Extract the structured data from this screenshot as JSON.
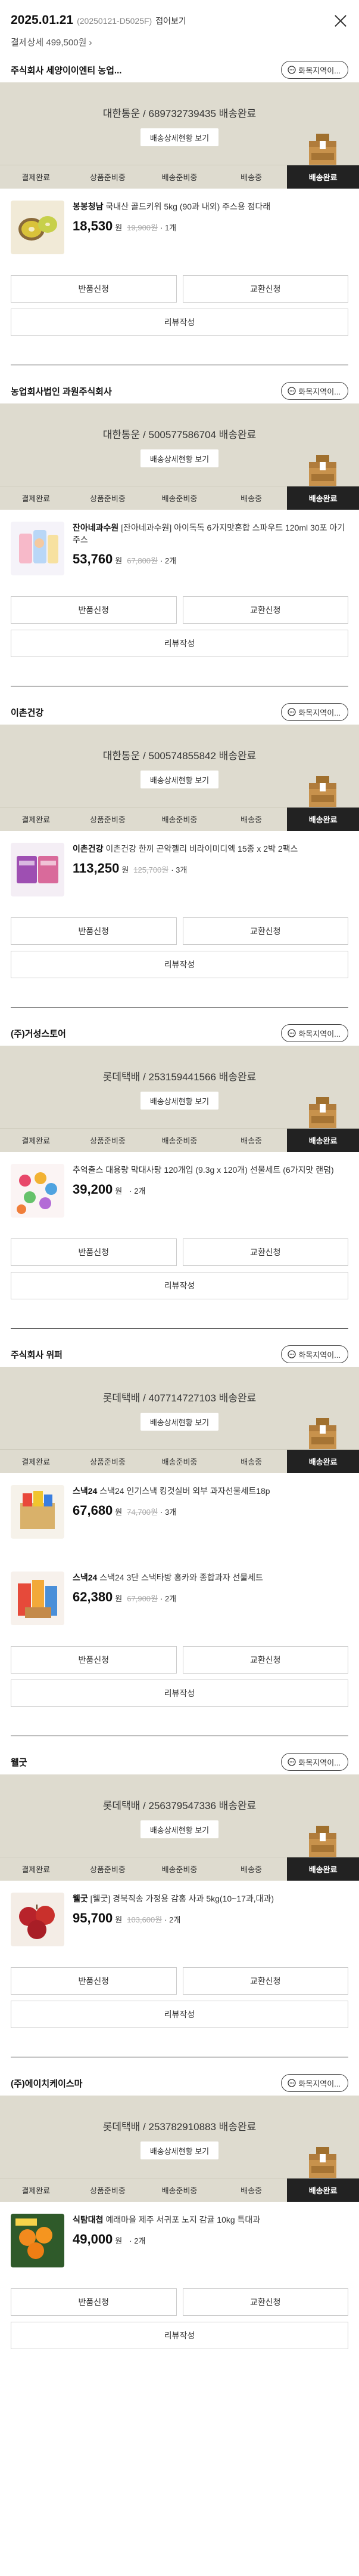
{
  "header": {
    "date": "2025.01.21",
    "order_id": "(20250121-D5025F)",
    "collapse_label": "접어보기",
    "payment": "결제상세 499,500원 ›"
  },
  "labels": {
    "seller_contact": "화목지역이...",
    "tracking_detail": "배송상세현황 보기",
    "return": "반품신청",
    "exchange": "교환신청",
    "review": "리뷰작성",
    "currency": "원"
  },
  "steps": [
    "결제완료",
    "상품준비중",
    "배송준비중",
    "배송중",
    "배송완료"
  ],
  "orders": [
    {
      "seller": "주식회사 세양이이엔티 농업...",
      "tracking": "대한통운 / 689732739435 배송완료",
      "items": [
        {
          "brand": "봉봉청남",
          "name": "국내산 골드키위 5kg (90과 내외) 주스용 점다래",
          "price": "18,530",
          "original": "19,900원",
          "qty": "· 1개",
          "thumb": "kiwi"
        }
      ]
    },
    {
      "seller": "농업회사법인 과원주식회사",
      "tracking": "대한통운 / 500577586704 배송완료",
      "items": [
        {
          "brand": "잔아네과수원",
          "name": "[잔아네과수원] 아이독독 6가지맛혼합 스파우트 120ml 30포 아기주스",
          "price": "53,760",
          "original": "67,800원",
          "qty": "· 2개",
          "thumb": "juice"
        }
      ]
    },
    {
      "seller": "이촌건강",
      "tracking": "대한통운 / 500574855842 배송완료",
      "items": [
        {
          "brand": "이촌건강",
          "name": "이촌건강 한끼 곤약젤리 비라이미디엑 15종 x 2박 2팩스",
          "price": "113,250",
          "original": "125,700원",
          "qty": "· 3개",
          "thumb": "jelly"
        }
      ]
    },
    {
      "seller": "(주)거성스토어",
      "tracking": "롯데택배 / 253159441566 배송완료",
      "items": [
        {
          "brand": "",
          "name": "추억출스 대용량 막대사탕 120개입 (9.3g x 120개) 선물세트 (6가지맛 랜덤)",
          "price": "39,200",
          "original": "",
          "qty": "· 2개",
          "thumb": "candy"
        }
      ]
    },
    {
      "seller": "주식회사 위퍼",
      "tracking": "롯데택배 / 407714727103 배송완료",
      "items": [
        {
          "brand": "스낵24",
          "name": "스낵24 인기스낵 킹것실버 외부 과자선물세트18p",
          "price": "67,680",
          "original": "74,700원",
          "qty": "· 3개",
          "thumb": "snack1"
        },
        {
          "brand": "스낵24",
          "name": "스낵24 3단 스낵타방 홍카와 종합과자 선물세트",
          "price": "62,380",
          "original": "67,900원",
          "qty": "· 2개",
          "thumb": "snack2"
        }
      ]
    },
    {
      "seller": "웰굿",
      "tracking": "롯데택배 / 256379547336 배송완료",
      "items": [
        {
          "brand": "웰굿",
          "name": "[웰굿] 경북직송 가정용 감홍 사과 5kg(10~17과,대과)",
          "price": "95,700",
          "original": "103,600원",
          "qty": "· 2개",
          "thumb": "apple"
        }
      ]
    },
    {
      "seller": "(주)에이치케이스마",
      "tracking": "롯데택배 / 253782910883 배송완료",
      "items": [
        {
          "brand": "식탐대첩",
          "name": "예래마을 제주 서귀포 노지 감귤 10kg 특대과",
          "price": "49,000",
          "original": "",
          "qty": "· 2개",
          "thumb": "orange"
        }
      ]
    }
  ],
  "colors": {
    "track_bg": "#dedbcf",
    "active_step": "#222222",
    "text": "#222222"
  }
}
